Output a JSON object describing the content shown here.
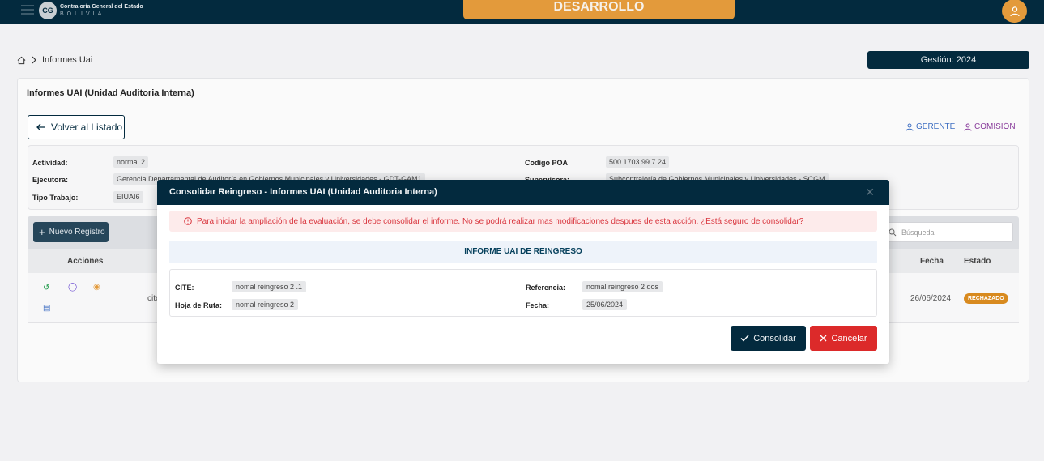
{
  "topbar": {
    "logo_title": "Contraloría General del Estado",
    "logo_subtitle": "BOLIVIA",
    "environment": "DESARROLLO"
  },
  "breadcrumb": {
    "current": "Informes Uai"
  },
  "gestion": "Gestión: 2024",
  "card": {
    "title": "Informes UAI (Unidad Auditoria Interna)",
    "back_label": "Volver al Listado",
    "roles": [
      "GERENTE",
      "COMISIÓN"
    ]
  },
  "info": {
    "actividad_label": "Actividad:",
    "actividad": "normal 2",
    "ejecutora_label": "Ejecutora:",
    "ejecutora": "Gerencia Departamental de Auditoría en Gobiernos Municipales y Universidades - GDT-GAM1",
    "tipo_label": "Tipo Trabajo:",
    "tipo": "EIUAI6",
    "poa_label": "Codigo POA",
    "poa": "500.1703.99.7.24",
    "supervisora_label": "Supervisora:",
    "supervisora": "Subcontraloría de Gobiernos Municipales y Universidades - SCGM"
  },
  "table": {
    "new_label": "Nuevo Registro",
    "search_placeholder": "Búsqueda",
    "headers": {
      "acciones": "Acciones",
      "fecha": "Fecha",
      "estado": "Estado"
    },
    "rows": [
      {
        "cite": "cite",
        "fecha": "26/06/2024",
        "estado": "RECHAZADO"
      }
    ]
  },
  "modal": {
    "title": "Consolidar Reingreso - Informes UAI (Unidad Auditoria Interna)",
    "alert": "Para iniciar la ampliación de la evaluación, se debe consolidar el informe. No se podrá realizar mas modificaciones despues de esta acción. ¿Está seguro de consolidar?",
    "section_title": "INFORME UAI DE REINGRESO",
    "cite_label": "CITE:",
    "cite": "nomal reingreso 2 .1",
    "hoja_label": "Hoja de Ruta:",
    "hoja": "nomal reingreso 2",
    "referencia_label": "Referencia:",
    "referencia": "nomal reingreso 2 dos",
    "fecha_label": "Fecha:",
    "fecha": "25/06/2024",
    "confirm_label": "Consolidar",
    "cancel_label": "Cancelar"
  },
  "colors": {
    "primary": "#032a3e",
    "accent": "#e39a3b",
    "danger": "#dc2a2a",
    "status_rechazado": "#d88a1f"
  }
}
